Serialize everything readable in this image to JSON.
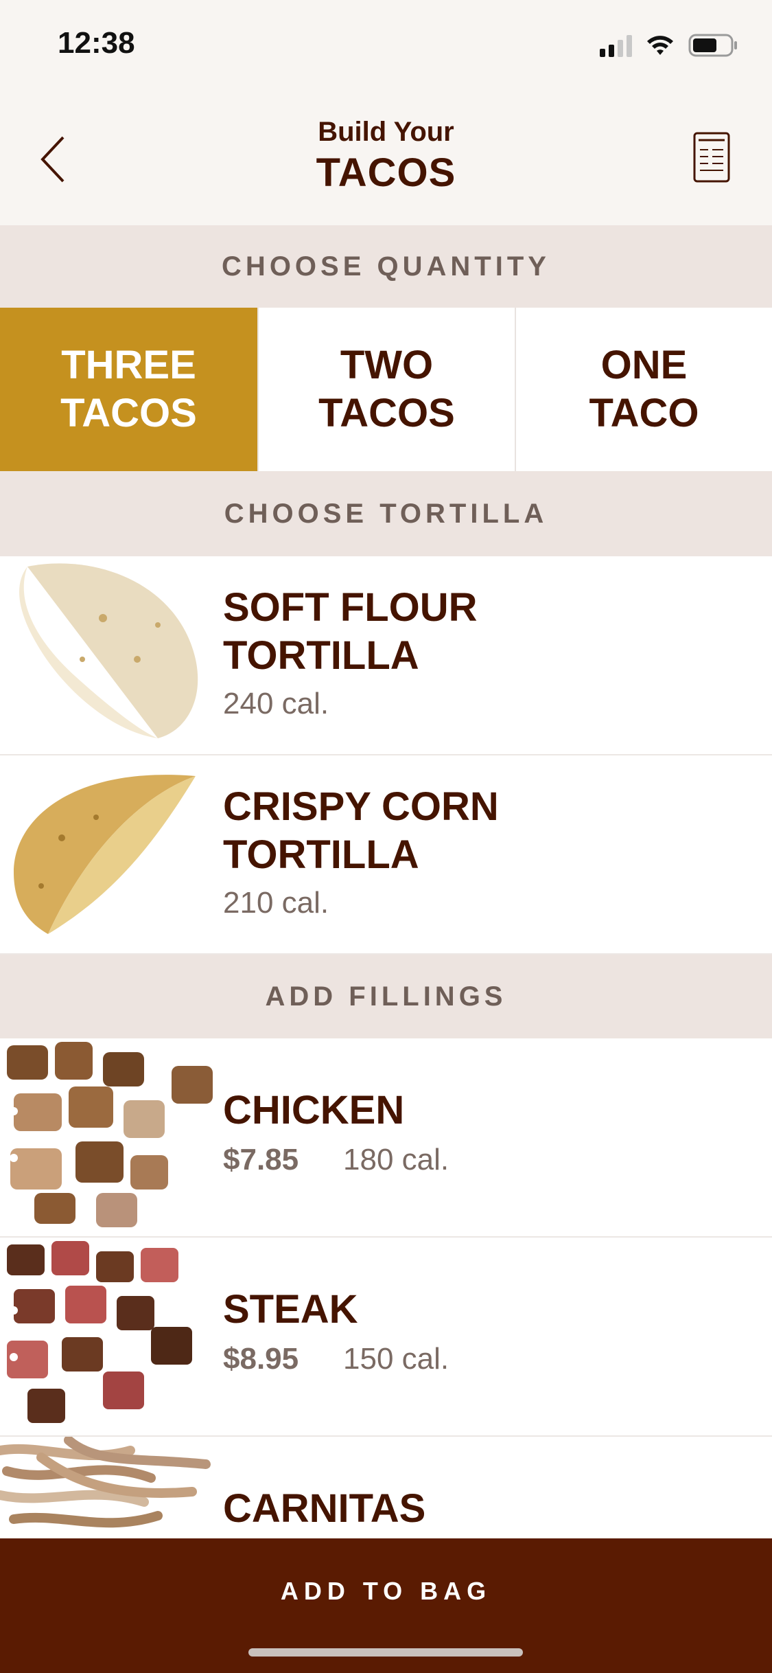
{
  "status_bar": {
    "time": "12:38"
  },
  "header": {
    "title_top": "Build Your",
    "title_main": "TACOS"
  },
  "sections": {
    "quantity": "CHOOSE QUANTITY",
    "tortilla": "CHOOSE TORTILLA",
    "fillings": "ADD FILLINGS"
  },
  "quantity_options": [
    {
      "line1": "THREE",
      "line2": "TACOS",
      "selected": true
    },
    {
      "line1": "TWO",
      "line2": "TACOS",
      "selected": false
    },
    {
      "line1": "ONE",
      "line2": "TACO",
      "selected": false
    }
  ],
  "tortillas": [
    {
      "line1": "SOFT FLOUR",
      "line2": "TORTILLA",
      "cal": "240 cal."
    },
    {
      "line1": "CRISPY CORN",
      "line2": "TORTILLA",
      "cal": "210 cal."
    }
  ],
  "fillings": [
    {
      "name": "CHICKEN",
      "price": "$7.85",
      "cal": "180 cal."
    },
    {
      "name": "STEAK",
      "price": "$8.95",
      "cal": "150 cal."
    },
    {
      "name": "CARNITAS"
    }
  ],
  "cta": {
    "label": "ADD TO BAG"
  },
  "colors": {
    "accent": "#c5911f",
    "brand_dark": "#5a1b02",
    "text": "#451400"
  }
}
